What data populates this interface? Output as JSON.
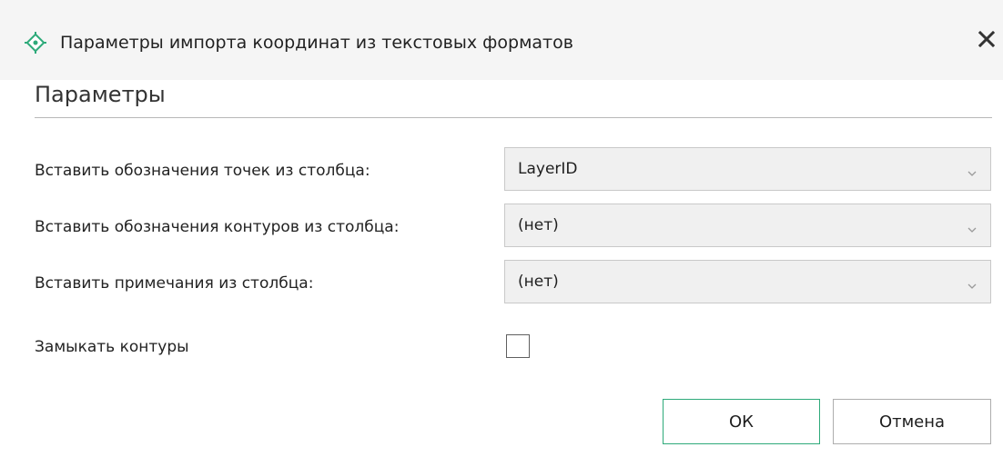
{
  "dialog": {
    "title": "Параметры импорта координат из текстовых форматов",
    "title_icon": "crosshair-point-icon",
    "close_icon": "close-icon",
    "accent_color": "#2eaa7a"
  },
  "section": {
    "title": "Параметры"
  },
  "fields": {
    "points_column": {
      "label": "Вставить обозначения точек из столбца:",
      "value": "LayerID"
    },
    "contours_column": {
      "label": "Вставить обозначения контуров из столбца:",
      "value": "(нет)"
    },
    "notes_column": {
      "label": "Вставить примечания из столбца:",
      "value": "(нет)"
    },
    "close_contours": {
      "label": "Замыкать контуры",
      "checked": false
    }
  },
  "buttons": {
    "ok": "ОК",
    "cancel": "Отмена"
  }
}
